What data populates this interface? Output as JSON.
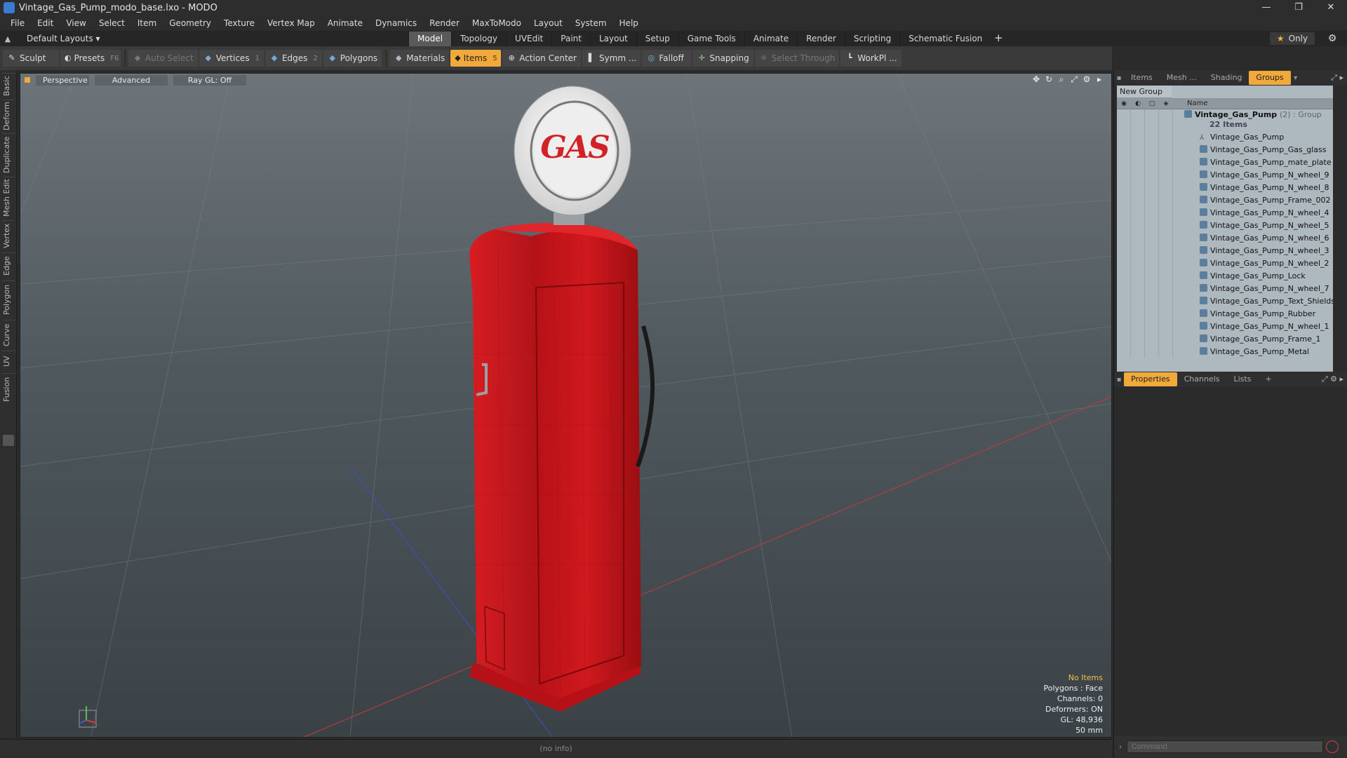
{
  "window": {
    "title": "Vintage_Gas_Pump_modo_base.lxo - MODO",
    "minimize": "—",
    "restore": "❐",
    "close": "✕"
  },
  "menu": [
    "File",
    "Edit",
    "View",
    "Select",
    "Item",
    "Geometry",
    "Texture",
    "Vertex Map",
    "Animate",
    "Dynamics",
    "Render",
    "MaxToModo",
    "Layout",
    "System",
    "Help"
  ],
  "layoutbar": {
    "layout_name": "Default Layouts ▾",
    "tabs": [
      "Model",
      "Topology",
      "UVEdit",
      "Paint",
      "Layout",
      "Setup",
      "Game Tools",
      "Animate",
      "Render",
      "Scripting",
      "Schematic Fusion"
    ],
    "active_tab": "Model",
    "add": "+",
    "only": "Only"
  },
  "toolbar": {
    "sculpt": "Sculpt",
    "presets": "Presets",
    "presets_key": "F6",
    "auto_select": "Auto Select",
    "vertices": "Vertices",
    "vertices_key": "1",
    "edges": "Edges",
    "edges_key": "2",
    "polygons": "Polygons",
    "materials": "Materials",
    "items": "Items",
    "items_key": "5",
    "action_center": "Action Center",
    "symm": "Symm ...",
    "falloff": "Falloff",
    "snapping": "Snapping",
    "select_through": "Select Through",
    "workpl": "WorkPl ..."
  },
  "left_tabs": [
    "Basic",
    "Deform",
    "Duplicate",
    "Mesh Edit",
    "Vertex",
    "Edge",
    "Polygon",
    "Curve",
    "UV",
    "Fusion"
  ],
  "viewport": {
    "view_mode": "Perspective",
    "shading": "Advanced",
    "raygl": "Ray GL: Off",
    "sign_text": "GAS",
    "info": {
      "items": "No Items",
      "polygons": "Polygons : Face",
      "channels": "Channels: 0",
      "deformers": "Deformers: ON",
      "gl": "GL: 48,936",
      "focal": "50 mm"
    },
    "colors": {
      "pump_red": "#c8161b",
      "sign_red": "#d32227",
      "bg_top": "#6d757a",
      "bg_bottom": "#3a4246"
    }
  },
  "status": {
    "info": "(no info)"
  },
  "right_panel": {
    "tabs": [
      "Items",
      "Mesh ...",
      "Shading",
      "Groups"
    ],
    "active_tab": "Groups",
    "new_group": "New Group",
    "name_col": "Name",
    "group": {
      "name": "Vintage_Gas_Pump",
      "suffix": "(2) : Group",
      "count": "22 Items"
    },
    "items": [
      "Vintage_Gas_Pump",
      "Vintage_Gas_Pump_Gas_glass",
      "Vintage_Gas_Pump_mate_plate",
      "Vintage_Gas_Pump_N_wheel_9",
      "Vintage_Gas_Pump_N_wheel_8",
      "Vintage_Gas_Pump_Frame_002",
      "Vintage_Gas_Pump_N_wheel_4",
      "Vintage_Gas_Pump_N_wheel_5",
      "Vintage_Gas_Pump_N_wheel_6",
      "Vintage_Gas_Pump_N_wheel_3",
      "Vintage_Gas_Pump_N_wheel_2",
      "Vintage_Gas_Pump_Lock",
      "Vintage_Gas_Pump_N_wheel_7",
      "Vintage_Gas_Pump_Text_Shields",
      "Vintage_Gas_Pump_Rubber",
      "Vintage_Gas_Pump_N_wheel_1",
      "Vintage_Gas_Pump_Frame_1",
      "Vintage_Gas_Pump_Metal"
    ],
    "lower_tabs": [
      "Properties",
      "Channels",
      "Lists"
    ],
    "lower_active": "Properties",
    "lower_add": "+",
    "command_placeholder": "Command"
  }
}
